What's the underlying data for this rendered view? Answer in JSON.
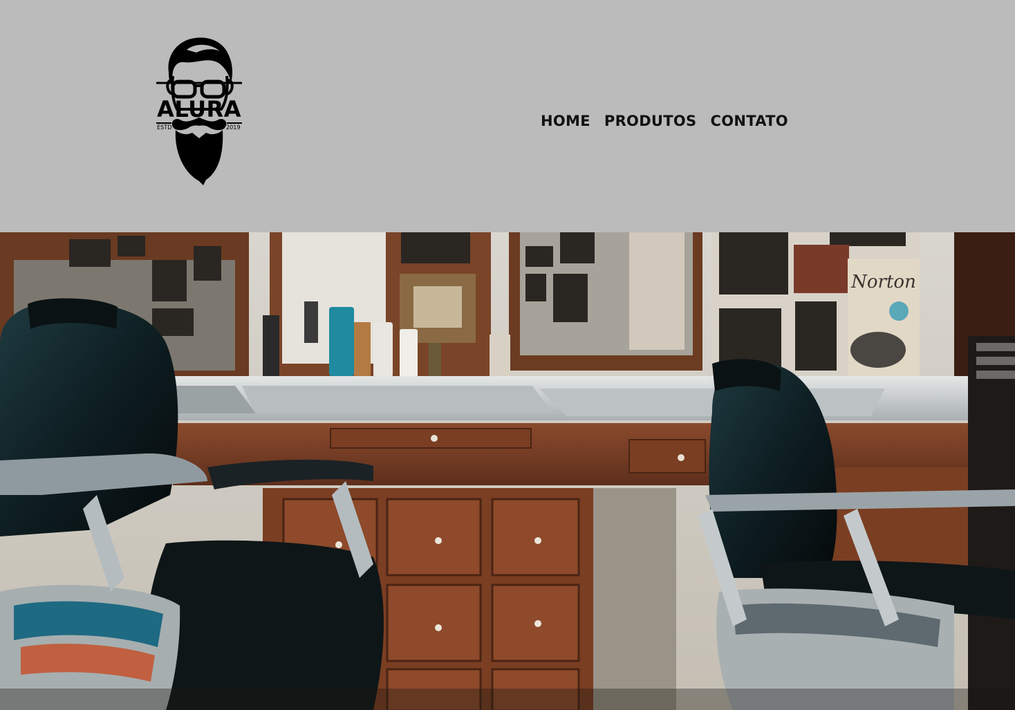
{
  "header": {
    "background": "#bbbbbb",
    "logo": {
      "icon": "bearded-man-with-glasses",
      "wordmark": "ALURA",
      "established_label": "ESTD",
      "established_year": "2019"
    },
    "nav": {
      "items": [
        {
          "label": "HOME"
        },
        {
          "label": "PRODUTOS"
        },
        {
          "label": "CONTATO"
        }
      ]
    }
  },
  "hero": {
    "image": "barbershop-interior-photo",
    "poster_text": "Norton"
  }
}
